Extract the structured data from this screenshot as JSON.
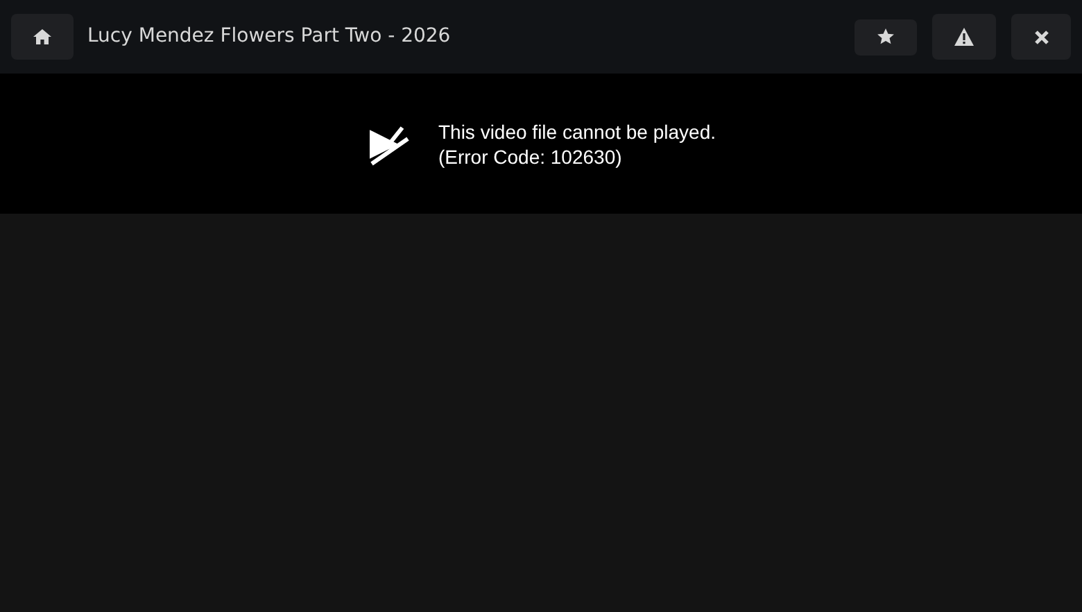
{
  "header": {
    "title": "Lucy Mendez Flowers Part Two - 2026"
  },
  "player": {
    "error_lines": [
      "This video file cannot be played.",
      "(Error Code: 102630)"
    ]
  }
}
